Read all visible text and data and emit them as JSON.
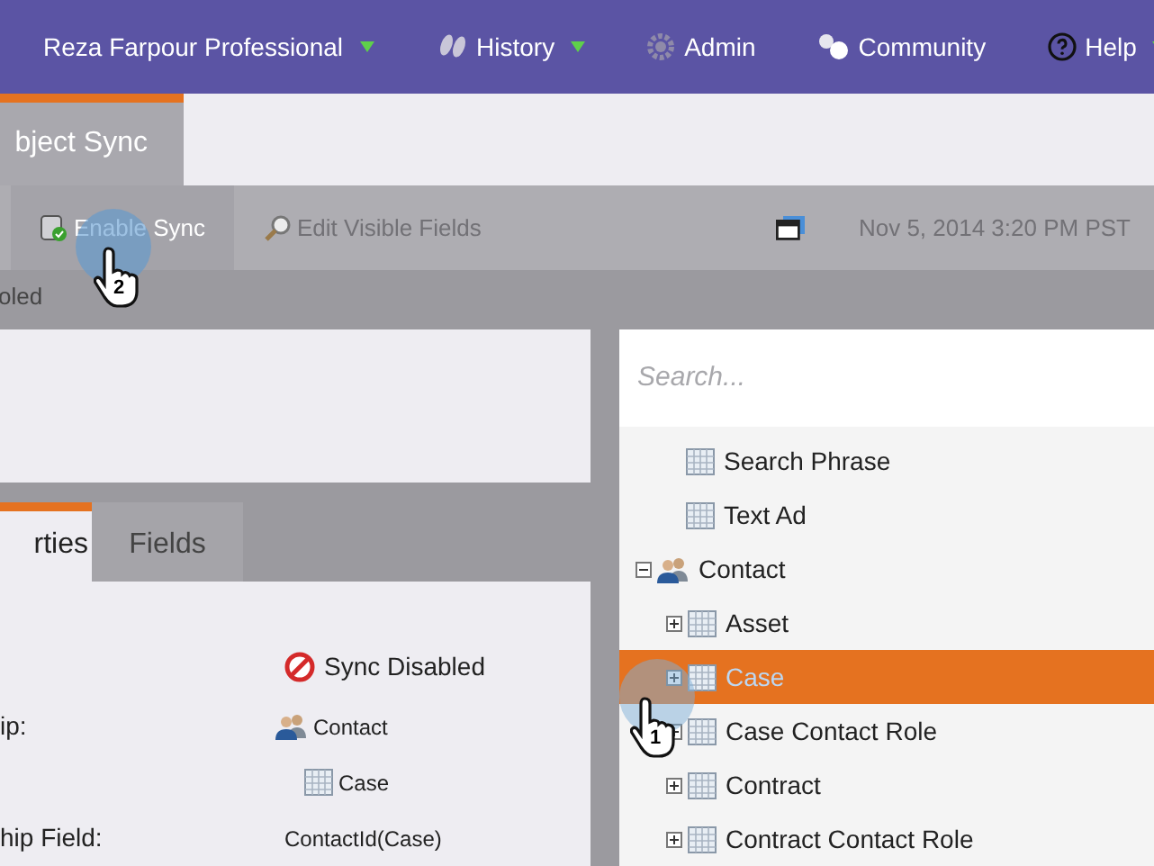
{
  "top_nav": [
    {
      "label": "Reza Farpour Professional",
      "kind": "account",
      "dropdown": true
    },
    {
      "label": "History",
      "kind": "history",
      "dropdown": true
    },
    {
      "label": "Admin",
      "kind": "admin",
      "dropdown": false
    },
    {
      "label": "Community",
      "kind": "community",
      "dropdown": false
    },
    {
      "label": "Help",
      "kind": "help",
      "dropdown": true
    }
  ],
  "page_tab": {
    "label": "bject Sync",
    "selected": true
  },
  "toolbar": {
    "buttons": [
      {
        "label": "Enable Sync",
        "kind": "enable",
        "selected": true
      },
      {
        "label": "Edit Visible Fields",
        "kind": "edit",
        "selected": false
      }
    ],
    "date": "Nov 5, 2014 3:20 PM PST"
  },
  "status_text": "oled",
  "detail_tabs": [
    {
      "label": "rties",
      "selected": true
    },
    {
      "label": "Fields",
      "selected": false
    }
  ],
  "properties": [
    {
      "value": "Sync Disabled",
      "kind": "status"
    },
    {
      "label": "ip:",
      "value": "Contact",
      "kind": "contact"
    },
    {
      "value": "Case",
      "kind": "table"
    },
    {
      "label": "hip Field:",
      "value": "ContactId(Case)",
      "kind": "text"
    }
  ],
  "search": {
    "placeholder": "Search..."
  },
  "tree": [
    {
      "label": "Search Phrase",
      "kind": "leaf",
      "selected": false
    },
    {
      "label": "Text Ad",
      "kind": "leaf",
      "selected": false
    },
    {
      "label": "Contact",
      "kind": "contact",
      "expanded": true,
      "selected": false,
      "children": [
        {
          "label": "Asset",
          "kind": "table",
          "expanded": false,
          "selected": false
        },
        {
          "label": "Case",
          "kind": "table",
          "expanded": false,
          "selected": true
        },
        {
          "label": "Case Contact Role",
          "kind": "table",
          "expanded": false,
          "selected": false
        },
        {
          "label": "Contract",
          "kind": "table",
          "expanded": false,
          "selected": false
        },
        {
          "label": "Contract Contact Role",
          "kind": "table",
          "expanded": false,
          "selected": false
        }
      ]
    }
  ],
  "cursors": [
    {
      "number": "2"
    },
    {
      "number": "1"
    }
  ]
}
